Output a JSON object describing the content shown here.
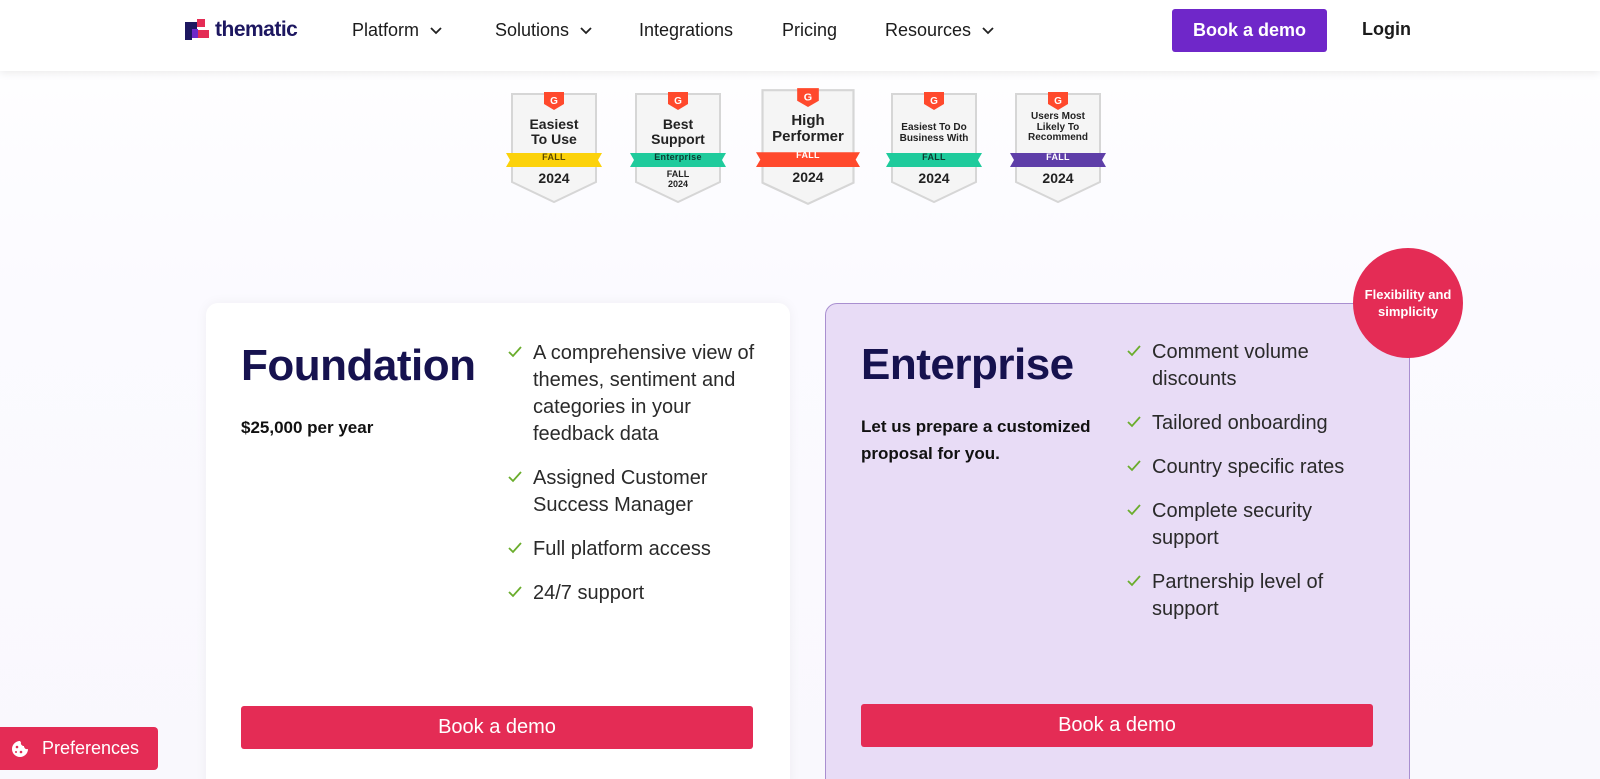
{
  "header": {
    "logo_text": "thematic",
    "nav": [
      {
        "label": "Platform",
        "has_dropdown": true
      },
      {
        "label": "Solutions",
        "has_dropdown": true
      },
      {
        "label": "Integrations",
        "has_dropdown": false
      },
      {
        "label": "Pricing",
        "has_dropdown": false
      },
      {
        "label": "Resources",
        "has_dropdown": true
      }
    ],
    "cta_label": "Book a demo",
    "login_label": "Login",
    "brand_color": "#6f27c9"
  },
  "badges": [
    {
      "title": "Easiest\nTo Use",
      "ribbon": "FALL",
      "year": "2024",
      "ribbon_color": "#fcd20a",
      "ribbon_text_color": "#5a4a00"
    },
    {
      "title": "Best\nSupport",
      "ribbon": "Enterprise",
      "season": "FALL\n2024",
      "ribbon_color": "#1fcb9c",
      "ribbon_text_color": "#0d3b31"
    },
    {
      "title": "High\nPerformer",
      "ribbon": "FALL",
      "year": "2024",
      "ribbon_color": "#ff492c",
      "ribbon_text_color": "#ffffff"
    },
    {
      "title": "Easiest To Do\nBusiness With",
      "ribbon": "FALL",
      "year": "2024",
      "ribbon_color": "#1fcb9c",
      "ribbon_text_color": "#0d3b31"
    },
    {
      "title": "Users Most\nLikely To\nRecommend",
      "ribbon": "FALL",
      "year": "2024",
      "ribbon_color": "#5e3ea8",
      "ribbon_text_color": "#ffffff"
    }
  ],
  "plans": {
    "foundation": {
      "title": "Foundation",
      "price": "$25,000 per year",
      "features": [
        "A comprehensive view of themes, sentiment and categories in your feedback data",
        "Assigned Customer Success Manager",
        "Full platform access",
        "24/7 support"
      ],
      "cta_label": "Book a demo"
    },
    "enterprise": {
      "title": "Enterprise",
      "subtitle": "Let us prepare a customized proposal for you.",
      "features": [
        "Comment volume discounts",
        "Tailored onboarding",
        "Country specific rates",
        "Complete security support",
        "Partnership level of support"
      ],
      "cta_label": "Book a demo",
      "highlight_badge": "Flexibility and simplicity"
    }
  },
  "preferences_label": "Preferences",
  "colors": {
    "accent_red": "#e42c55",
    "check_green": "#6aad2c",
    "enterprise_bg": "#e8dcf6",
    "title_navy": "#16124f"
  }
}
